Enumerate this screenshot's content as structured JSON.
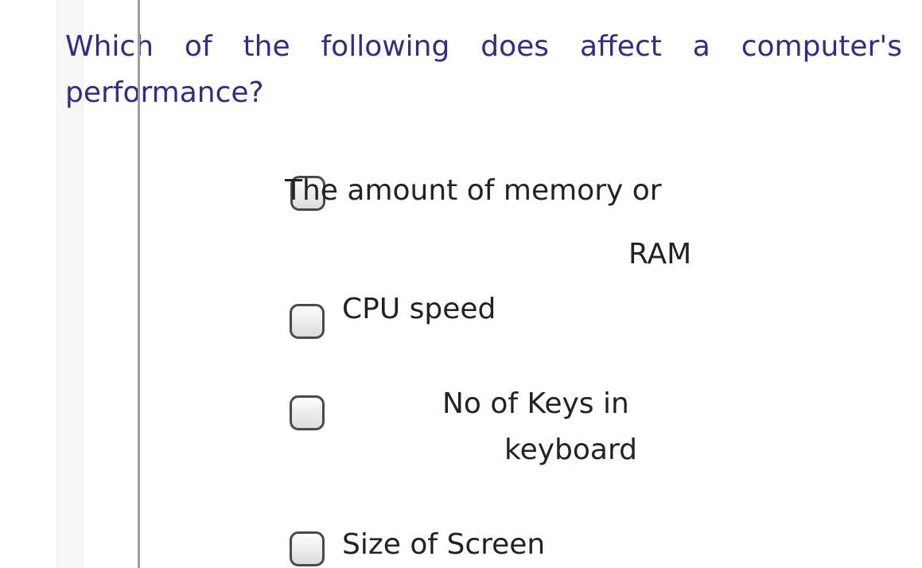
{
  "question": {
    "text": "Which of the following does affect a computer's performance?"
  },
  "options": [
    {
      "label_line1": "The amount of memory or",
      "label_line2": "RAM",
      "checked": false
    },
    {
      "label_line1": "CPU speed",
      "checked": false
    },
    {
      "label_line1": "No of Keys in",
      "label_line2": "keyboard",
      "checked": false
    },
    {
      "label_line1": "Size of Screen",
      "checked": false
    }
  ],
  "colors": {
    "question_text": "#2e2e86",
    "option_text": "#222222",
    "checkbox_border": "#4a4a4a"
  }
}
